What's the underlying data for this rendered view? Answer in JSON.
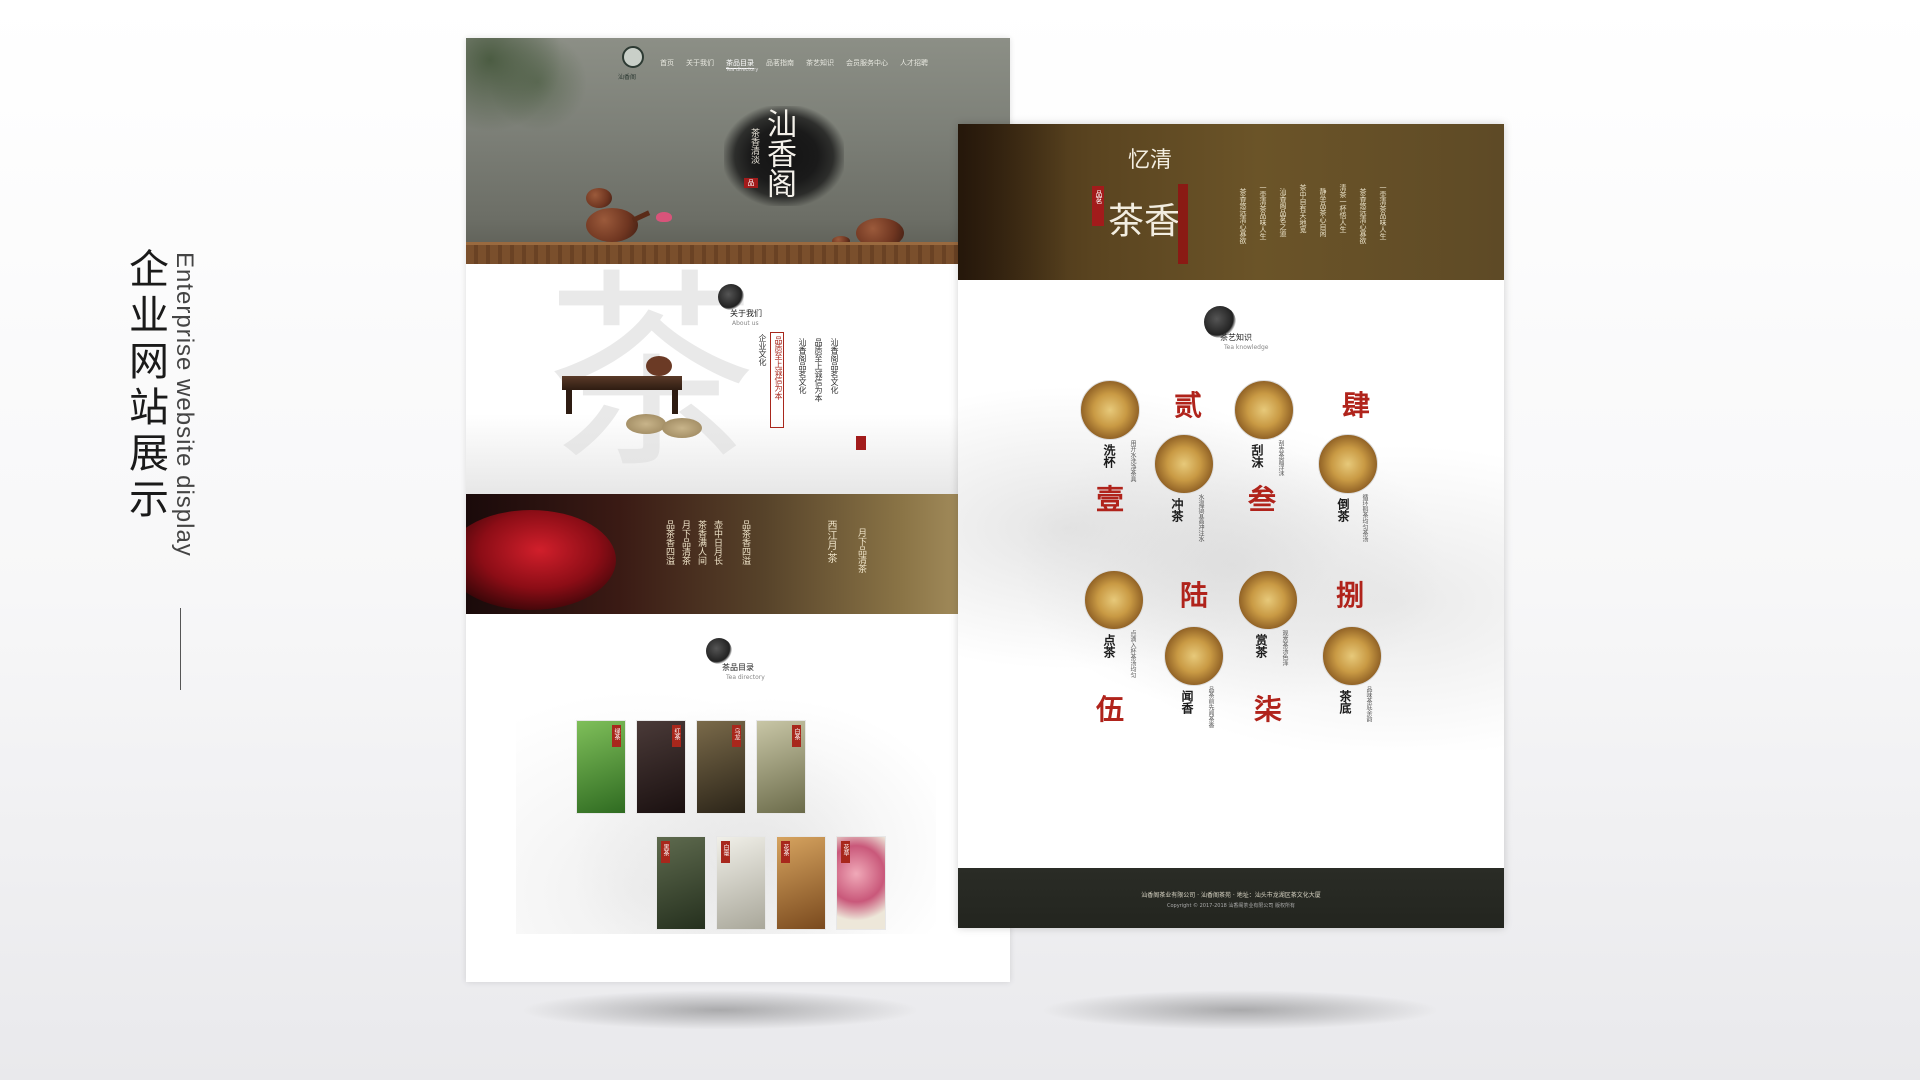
{
  "showcase": {
    "title_cn": "企业网站展示",
    "title_en": "Enterprise website display"
  },
  "page1": {
    "logo_text": "汕香阁",
    "nav": [
      "首页",
      "关于我们",
      "茶品目录",
      "品茗指南",
      "茶艺知识",
      "会员服务中心",
      "人才招聘"
    ],
    "nav_active_sub": "Tea directory",
    "hero": {
      "title": "汕香阁",
      "subtitle": "茶香清淡",
      "seal": "品"
    },
    "about": {
      "bg_char": "茶",
      "title": "关于我们",
      "sub": "About us",
      "col1": "品质至上诚信为本",
      "col2": "汕香阁品茗文化",
      "heading": "企业文化"
    },
    "banner": {
      "col_a": "西江月·茶",
      "col_b": "品茶香四溢",
      "col_c": "月下品清茶",
      "col_d": "茶香满人间",
      "col_e": "壶中日月长"
    },
    "products": {
      "title": "茶品目录",
      "sub": "Tea directory",
      "row1_tags": [
        "绿茶",
        "红茶",
        "乌龙",
        "白茶"
      ],
      "row2_tags": [
        "黑茶",
        "白毫",
        "花茶",
        "花草"
      ]
    }
  },
  "page2": {
    "header": {
      "title_top": "忆清",
      "title_main": "茶香",
      "red_tag": "品茗",
      "vert_text": [
        "茶香悠远清心寡欲",
        "一壶清茶品味人生",
        "汕香阁品茗之道",
        "茶中自有天地宽",
        "静坐品茶心自闲",
        "清茶一杯悟人生"
      ]
    },
    "section": {
      "title": "茶艺知识",
      "sub": "Tea knowledge"
    },
    "numerals": [
      "贰",
      "肆",
      "壹",
      "叁",
      "陆",
      "捌",
      "伍",
      "柒"
    ],
    "steps": [
      {
        "label": "洗杯",
        "desc": "用开水洗净茶具"
      },
      {
        "label": "冲茶",
        "desc": "水温适宜高冲注水"
      },
      {
        "label": "刮沫",
        "desc": "刮去茶面浮沫"
      },
      {
        "label": "倒茶",
        "desc": "循环斟茶均匀茶汤"
      },
      {
        "label": "点茶",
        "desc": "点滴入杯茶汤均匀"
      },
      {
        "label": "闻香",
        "desc": "品茶前先闻茶香"
      },
      {
        "label": "赏茶",
        "desc": "观赏茶汤色泽"
      },
      {
        "label": "茶底",
        "desc": "品味茶底余韵"
      }
    ],
    "footer": {
      "line1": "汕香阁茶业有限公司 · 汕香阁茶苑 · 地址：汕头市龙湖区茶文化大厦",
      "line2": "Copyright © 2017-2018 汕香阁茶业有限公司 版权所有"
    }
  }
}
